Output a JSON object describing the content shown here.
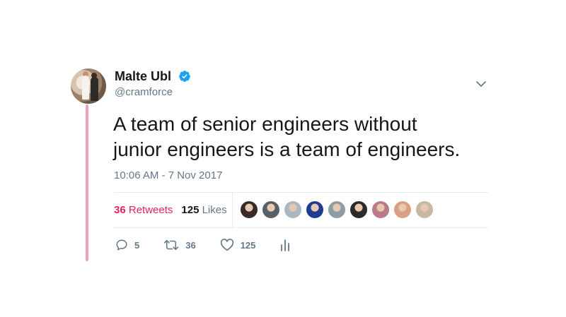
{
  "user": {
    "name": "Malte Ubl",
    "handle": "@cramforce",
    "verified": true
  },
  "tweet": {
    "text_line1": "A team of senior engineers without",
    "text_line2": "junior engineers is a team of engineers.",
    "timestamp": "10:06 AM - 7 Nov 2017"
  },
  "stats": {
    "retweets_count": "36",
    "retweets_label": "Retweets",
    "likes_count": "125",
    "likes_label": "Likes"
  },
  "actions": {
    "reply_count": "5",
    "retweet_count": "36",
    "like_count": "125"
  },
  "colors": {
    "thread_line": "#f2a1b5",
    "verified": "#1da1f2",
    "retweet_text": "#e0245e",
    "muted": "#657786"
  },
  "likers": [
    {
      "name": "liker-1",
      "color": "#3a2a28"
    },
    {
      "name": "liker-2",
      "color": "#55606a"
    },
    {
      "name": "liker-3",
      "color": "#aab8c2"
    },
    {
      "name": "liker-4",
      "color": "#1f3c8f"
    },
    {
      "name": "liker-5",
      "color": "#8d9ca7"
    },
    {
      "name": "liker-6",
      "color": "#2b2b2b"
    },
    {
      "name": "liker-7",
      "color": "#b97a8a"
    },
    {
      "name": "liker-8",
      "color": "#d9a083"
    },
    {
      "name": "liker-9",
      "color": "#c8b7a2"
    }
  ]
}
